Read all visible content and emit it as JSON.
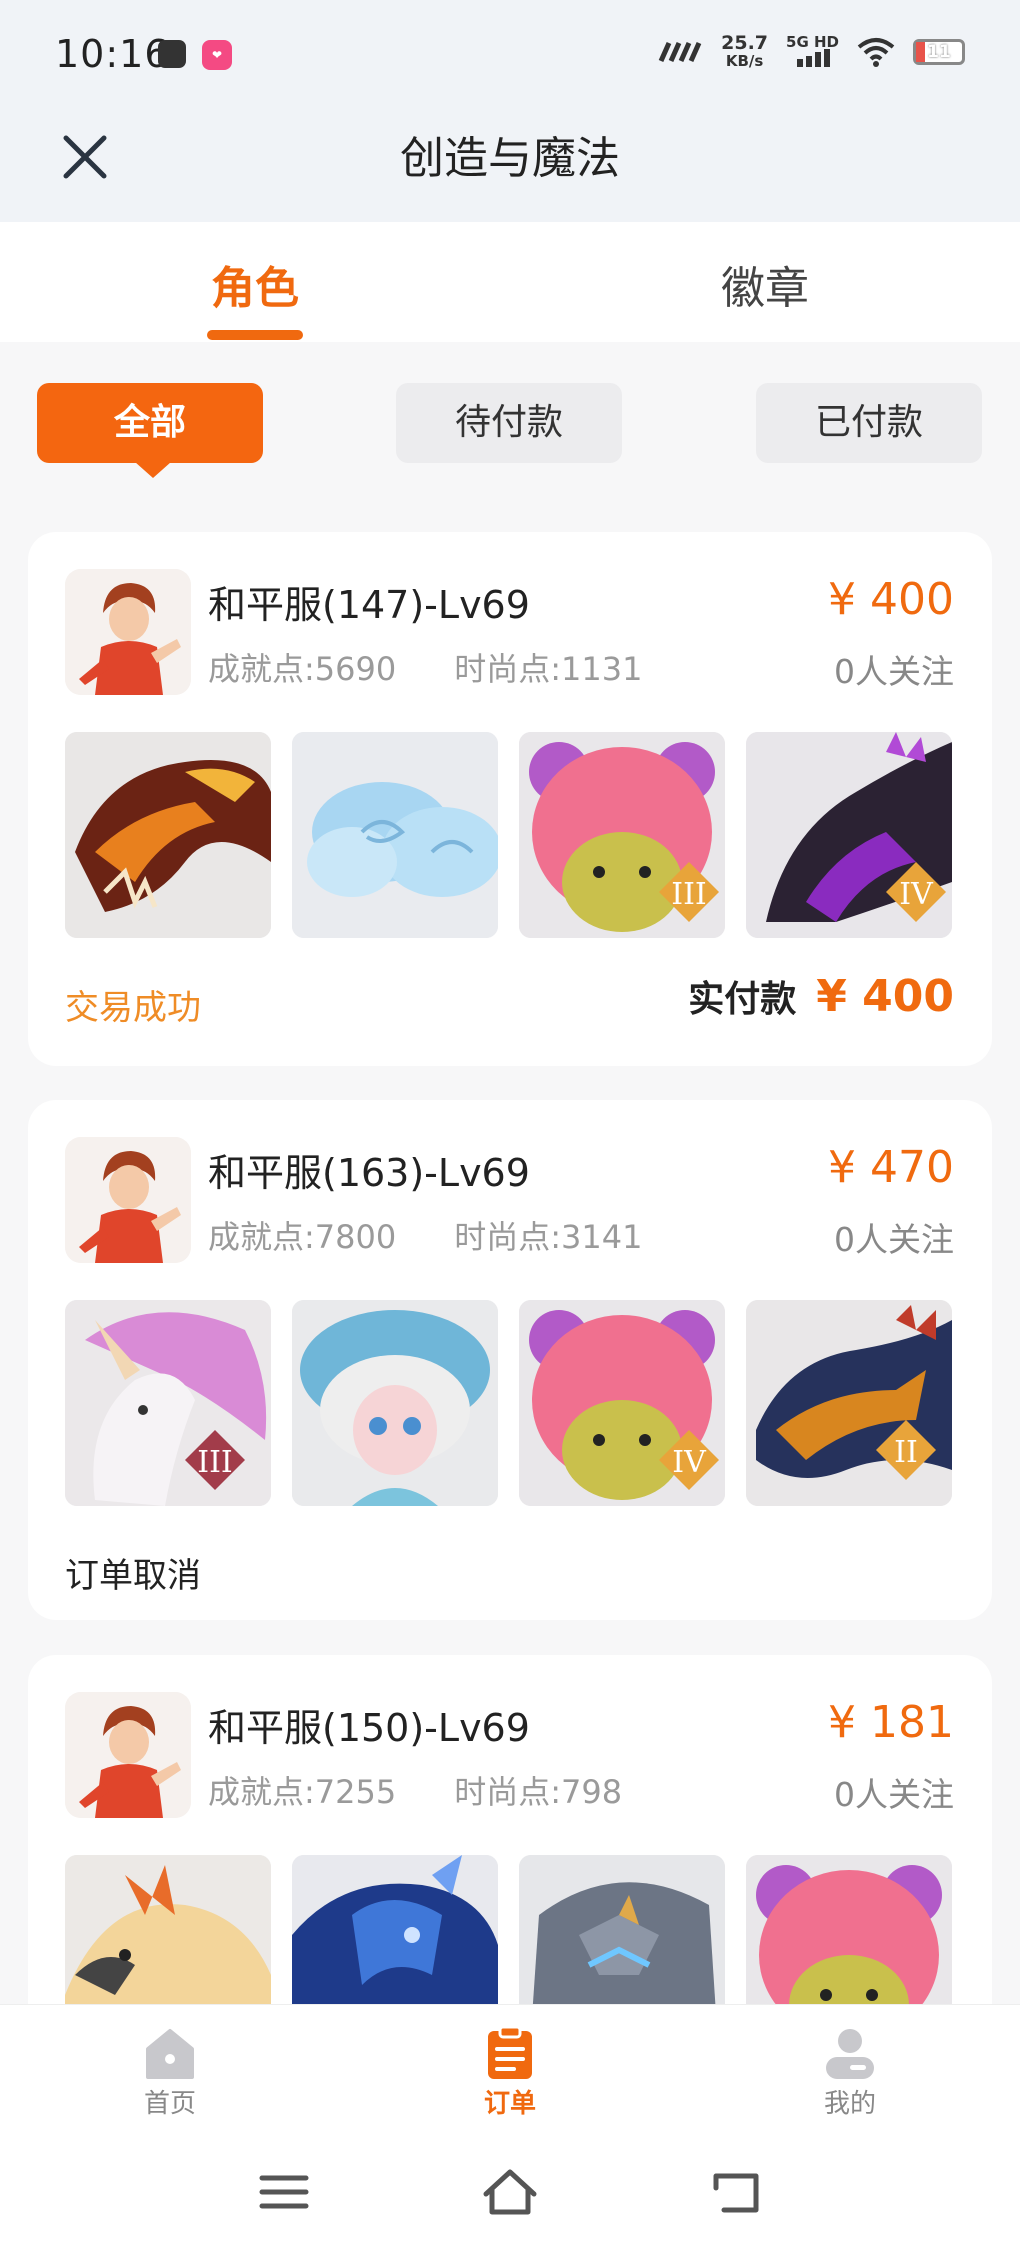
{
  "status_bar": {
    "time": "10:16",
    "app_icon_b_text": "❤",
    "speed_value": "25.7",
    "speed_unit": "KB/s",
    "network_top": "5G HD",
    "battery": "11",
    "battery_level": 0.11
  },
  "header": {
    "title": "创造与魔法"
  },
  "tabs": [
    {
      "label": "角色",
      "active": true
    },
    {
      "label": "徽章",
      "active": false
    }
  ],
  "filters": [
    {
      "label": "全部",
      "active": true
    },
    {
      "label": "待付款",
      "active": false
    },
    {
      "label": "已付款",
      "active": false
    }
  ],
  "orders": [
    {
      "server": "和平服(147)-Lv69",
      "achievement": "成就点:5690",
      "fashion": "时尚点:1131",
      "price": "¥ 400",
      "watchers": "0人关注",
      "status": "交易成功",
      "paid_label": "实付款",
      "paid_value": "¥ 400",
      "items": [
        "red-dragon-mount",
        "cloud-mount",
        "pink-bear-mount-III",
        "purple-dragon-mount-IV"
      ]
    },
    {
      "server": "和平服(163)-Lv69",
      "achievement": "成就点:7800",
      "fashion": "时尚点:3141",
      "price": "¥ 470",
      "watchers": "0人关注",
      "status": "订单取消",
      "items": [
        "unicorn-mount-III",
        "sheep-girl-mount",
        "pink-bear-mount-IV",
        "golden-dragon-mount-II"
      ]
    },
    {
      "server": "和平服(150)-Lv69",
      "achievement": "成就点:7255",
      "fashion": "时尚点:798",
      "price": "¥ 181",
      "watchers": "0人关注",
      "items": [
        "phoenix-mount",
        "blue-horse-mount",
        "stone-golem-mount-II",
        "pink-bear-mount-IV"
      ]
    }
  ],
  "bottom_nav": [
    {
      "label": "首页",
      "icon": "home-icon",
      "active": false
    },
    {
      "label": "订单",
      "icon": "order-icon",
      "active": true
    },
    {
      "label": "我的",
      "icon": "user-icon",
      "active": false
    }
  ],
  "colors": {
    "accent": "#f0690f",
    "success": "#ef8c26",
    "muted": "#9a9a9a"
  }
}
